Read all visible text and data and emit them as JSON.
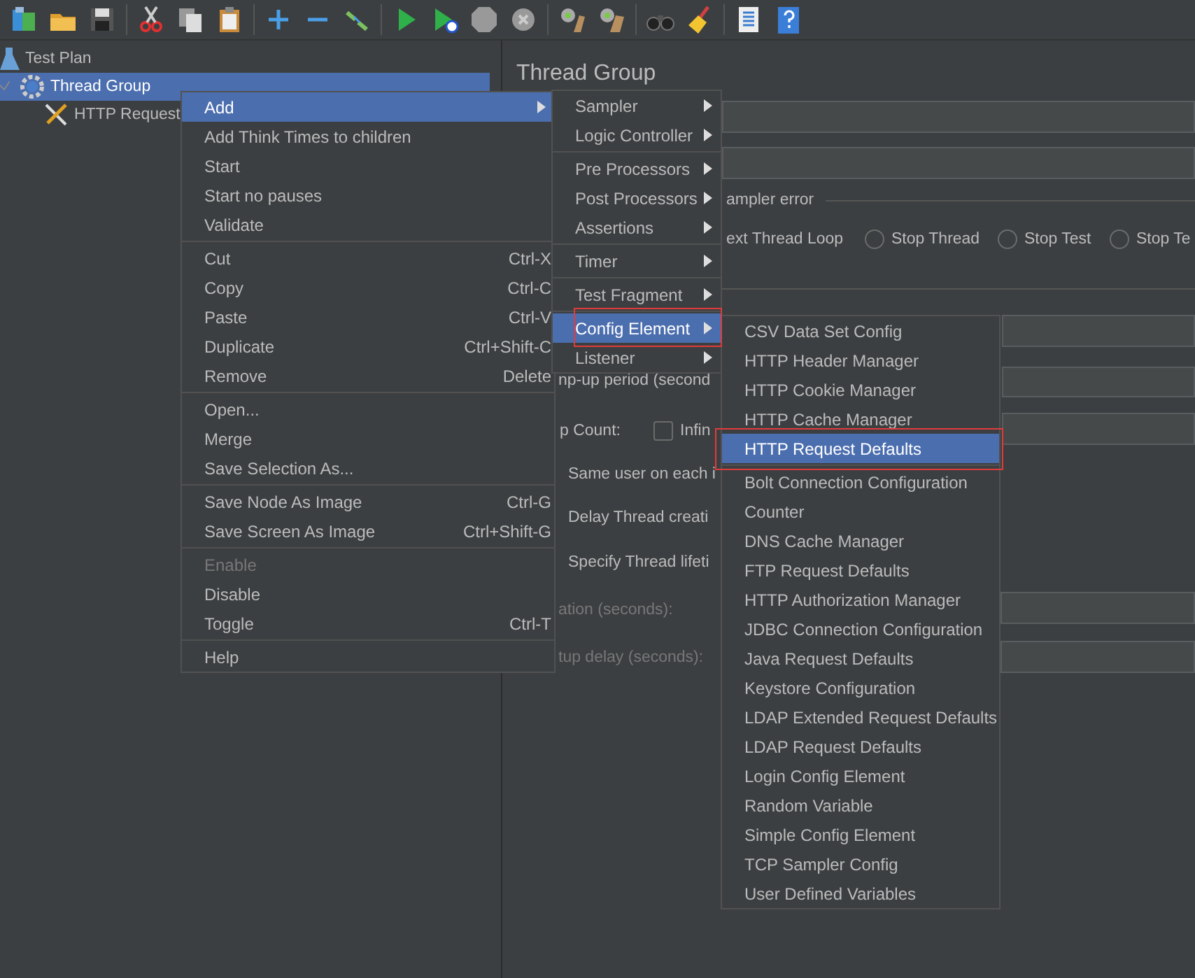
{
  "tree": [
    {
      "label": "Test Plan",
      "kind": "plan",
      "selected": false,
      "children": [
        {
          "label": "Thread Group",
          "kind": "thread-group",
          "selected": true,
          "children": [
            {
              "label": "HTTP Request",
              "kind": "sampler",
              "selected": false
            }
          ]
        }
      ]
    }
  ],
  "editor": {
    "title": "Thread Group",
    "parts": [
      {
        "kind": "field"
      },
      {
        "kind": "field"
      },
      {
        "kind": "group-title",
        "label": "ampler error"
      },
      {
        "kind": "label",
        "label": "ext Thread Loop",
        "disabled": false
      },
      {
        "kind": "radio",
        "label": "Stop Thread",
        "selected": false
      },
      {
        "kind": "radio",
        "label": "Stop Test",
        "selected": false
      },
      {
        "kind": "radio",
        "label": "Stop Te",
        "selected": false
      },
      {
        "kind": "field"
      },
      {
        "kind": "label",
        "label": "np-up period (second",
        "disabled": false
      },
      {
        "kind": "field"
      },
      {
        "kind": "label",
        "label": "p Count:",
        "disabled": false
      },
      {
        "kind": "checkbox",
        "label": "Infin",
        "checked": false
      },
      {
        "kind": "field"
      },
      {
        "kind": "label",
        "label": "Same user on each i",
        "disabled": false
      },
      {
        "kind": "label",
        "label": "Delay Thread creati",
        "disabled": false
      },
      {
        "kind": "label",
        "label": "Specify Thread lifeti",
        "disabled": false
      },
      {
        "kind": "label",
        "label": "ation (seconds):",
        "disabled": true
      },
      {
        "kind": "field"
      },
      {
        "kind": "label",
        "label": "tup delay (seconds):",
        "disabled": true
      },
      {
        "kind": "field"
      }
    ]
  },
  "context_menu": {
    "groups": [
      [
        {
          "label": "Add",
          "has_submenu": true,
          "selected": true,
          "disabled": false
        },
        {
          "label": "Add Think Times to children",
          "has_submenu": false,
          "selected": false,
          "disabled": false
        },
        {
          "label": "Start",
          "has_submenu": false,
          "selected": false,
          "disabled": false
        },
        {
          "label": "Start no pauses",
          "has_submenu": false,
          "selected": false,
          "disabled": false
        },
        {
          "label": "Validate",
          "has_submenu": false,
          "selected": false,
          "disabled": false
        }
      ],
      [
        {
          "label": "Cut",
          "shortcut": "Ctrl-X",
          "has_submenu": false,
          "selected": false,
          "disabled": false
        },
        {
          "label": "Copy",
          "shortcut": "Ctrl-C",
          "has_submenu": false,
          "selected": false,
          "disabled": false
        },
        {
          "label": "Paste",
          "shortcut": "Ctrl-V",
          "has_submenu": false,
          "selected": false,
          "disabled": false
        },
        {
          "label": "Duplicate",
          "shortcut": "Ctrl+Shift-C",
          "has_submenu": false,
          "selected": false,
          "disabled": false
        },
        {
          "label": "Remove",
          "shortcut": "Delete",
          "has_submenu": false,
          "selected": false,
          "disabled": false
        }
      ],
      [
        {
          "label": "Open...",
          "has_submenu": false,
          "selected": false,
          "disabled": false
        },
        {
          "label": "Merge",
          "has_submenu": false,
          "selected": false,
          "disabled": false
        },
        {
          "label": "Save Selection As...",
          "has_submenu": false,
          "selected": false,
          "disabled": false
        }
      ],
      [
        {
          "label": "Save Node As Image",
          "shortcut": "Ctrl-G",
          "has_submenu": false,
          "selected": false,
          "disabled": false
        },
        {
          "label": "Save Screen As Image",
          "shortcut": "Ctrl+Shift-G",
          "has_submenu": false,
          "selected": false,
          "disabled": false
        }
      ],
      [
        {
          "label": "Enable",
          "has_submenu": false,
          "selected": false,
          "disabled": true
        },
        {
          "label": "Disable",
          "has_submenu": false,
          "selected": false,
          "disabled": false
        },
        {
          "label": "Toggle",
          "shortcut": "Ctrl-T",
          "has_submenu": false,
          "selected": false,
          "disabled": false
        }
      ],
      [
        {
          "label": "Help",
          "has_submenu": false,
          "selected": false,
          "disabled": false
        }
      ]
    ]
  },
  "add_submenu": {
    "groups": [
      [
        {
          "label": "Sampler",
          "has_submenu": true,
          "selected": false,
          "highlighted": false
        },
        {
          "label": "Logic Controller",
          "has_submenu": true,
          "selected": false,
          "highlighted": false
        }
      ],
      [
        {
          "label": "Pre Processors",
          "has_submenu": true,
          "selected": false,
          "highlighted": false
        },
        {
          "label": "Post Processors",
          "has_submenu": true,
          "selected": false,
          "highlighted": false
        },
        {
          "label": "Assertions",
          "has_submenu": true,
          "selected": false,
          "highlighted": false
        }
      ],
      [
        {
          "label": "Timer",
          "has_submenu": true,
          "selected": false,
          "highlighted": false
        }
      ],
      [
        {
          "label": "Test Fragment",
          "has_submenu": true,
          "selected": false,
          "highlighted": false
        }
      ],
      [
        {
          "label": "Config Element",
          "has_submenu": true,
          "selected": true,
          "highlighted": true
        },
        {
          "label": "Listener",
          "has_submenu": true,
          "selected": false,
          "highlighted": false
        }
      ]
    ]
  },
  "config_element_submenu": {
    "groups": [
      [
        {
          "label": "CSV Data Set Config",
          "has_submenu": false,
          "selected": false,
          "highlighted": false
        },
        {
          "label": "HTTP Header Manager",
          "has_submenu": false,
          "selected": false,
          "highlighted": false
        },
        {
          "label": "HTTP Cookie Manager",
          "has_submenu": false,
          "selected": false,
          "highlighted": false
        },
        {
          "label": "HTTP Cache Manager",
          "has_submenu": false,
          "selected": false,
          "highlighted": false
        },
        {
          "label": "HTTP Request Defaults",
          "has_submenu": false,
          "selected": true,
          "highlighted": true
        }
      ],
      [
        {
          "label": "Bolt Connection Configuration",
          "has_submenu": false,
          "selected": false,
          "highlighted": false
        },
        {
          "label": "Counter",
          "has_submenu": false,
          "selected": false,
          "highlighted": false
        },
        {
          "label": "DNS Cache Manager",
          "has_submenu": false,
          "selected": false,
          "highlighted": false
        },
        {
          "label": "FTP Request Defaults",
          "has_submenu": false,
          "selected": false,
          "highlighted": false
        },
        {
          "label": "HTTP Authorization Manager",
          "has_submenu": false,
          "selected": false,
          "highlighted": false
        },
        {
          "label": "JDBC Connection Configuration",
          "has_submenu": false,
          "selected": false,
          "highlighted": false
        },
        {
          "label": "Java Request Defaults",
          "has_submenu": false,
          "selected": false,
          "highlighted": false
        },
        {
          "label": "Keystore Configuration",
          "has_submenu": false,
          "selected": false,
          "highlighted": false
        },
        {
          "label": "LDAP Extended Request Defaults",
          "has_submenu": false,
          "selected": false,
          "highlighted": false
        },
        {
          "label": "LDAP Request Defaults",
          "has_submenu": false,
          "selected": false,
          "highlighted": false
        },
        {
          "label": "Login Config Element",
          "has_submenu": false,
          "selected": false,
          "highlighted": false
        },
        {
          "label": "Random Variable",
          "has_submenu": false,
          "selected": false,
          "highlighted": false
        },
        {
          "label": "Simple Config Element",
          "has_submenu": false,
          "selected": false,
          "highlighted": false
        },
        {
          "label": "TCP Sampler Config",
          "has_submenu": false,
          "selected": false,
          "highlighted": false
        },
        {
          "label": "User Defined Variables",
          "has_submenu": false,
          "selected": false,
          "highlighted": false
        }
      ]
    ]
  }
}
